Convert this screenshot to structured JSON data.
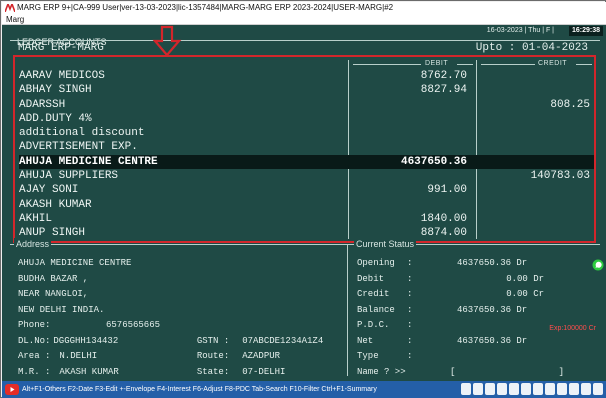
{
  "window": {
    "title": "MARG ERP 9+|CA-999 User|ver-13-03-2023|lic-1357484|MARG-MARG ERP 2023-2024|USER-MARG|#2"
  },
  "menu": {
    "label": "Marg"
  },
  "appbar": {
    "date": "16-03-2023 | Thu | F |",
    "time": "16:29:38"
  },
  "screen": {
    "title": "LEDGER ACCOUNTS",
    "company": "MARG ERP-MARG",
    "upto": "Upto : 01-04-2023"
  },
  "ledger": {
    "col_debit": "DEBIT",
    "col_credit": "CREDIT",
    "rows": [
      {
        "name": "AARAV MEDICOS",
        "debit": "8762.70",
        "credit": ""
      },
      {
        "name": "ABHAY SINGH",
        "debit": "8827.94",
        "credit": ""
      },
      {
        "name": "ADARSSH",
        "debit": "",
        "credit": "808.25"
      },
      {
        "name": "ADD.DUTY 4%",
        "debit": "",
        "credit": ""
      },
      {
        "name": "additional discount",
        "debit": "",
        "credit": ""
      },
      {
        "name": "ADVERTISEMENT EXP.",
        "debit": "",
        "credit": ""
      },
      {
        "name": "AHUJA MEDICINE CENTRE",
        "debit": "4637650.36",
        "credit": ""
      },
      {
        "name": "AHUJA SUPPLIERS",
        "debit": "",
        "credit": "140783.03"
      },
      {
        "name": "AJAY SONI",
        "debit": "991.00",
        "credit": ""
      },
      {
        "name": "AKASH KUMAR",
        "debit": "",
        "credit": ""
      },
      {
        "name": "AKHIL",
        "debit": "1840.00",
        "credit": ""
      },
      {
        "name": "ANUP SINGH",
        "debit": "8874.00",
        "credit": ""
      }
    ]
  },
  "address": {
    "heading": "Address",
    "line1": "AHUJA MEDICINE CENTRE",
    "line2": "BUDHA BAZAR ,",
    "line3": "NEAR NANGLOI,",
    "line4": "NEW DELHI INDIA.",
    "phone_label": "Phone:",
    "phone": "6576565665",
    "dlno_label": "DL.No:",
    "dlno": "DGGGHH134432",
    "gstn_label": "GSTN :",
    "gstn": "07ABCDE1234A1Z4",
    "area_label": "Area :",
    "area": "N.DELHI",
    "route_label": "Route:",
    "route": "AZADPUR",
    "mr_label": "M.R. :",
    "mr": "AKASH KUMAR",
    "state_label": "State:",
    "state": "07-DELHI"
  },
  "status": {
    "heading": "Current Status",
    "opening_label": "Opening",
    "opening": "4637650.36 Dr",
    "debit_label": "Debit",
    "debit": "0.00 Dr",
    "credit_label": "Credit",
    "credit": "0.00 Cr",
    "balance_label": "Balance",
    "balance": "4637650.36 Dr",
    "pdc_label": "P.D.C.",
    "pdc_exp": "Exp:100000 Cr",
    "net_label": "Net",
    "net": "4637650.36 Dr",
    "type_label": "Type",
    "name_label": "Name ? >>",
    "name_open": "[",
    "name_close": "]"
  },
  "footer": {
    "keys": "Alt+F1-Others F2-Date F3-Edit +-Envelope F4-Interest F6-Adjust F8-PDC Tab-Search F10-Filter Ctrl+F1-Summary"
  },
  "colors": {
    "screen_bg": "#1f4a45",
    "highlight_box": "#d3262b",
    "selected_row": "#091a18",
    "footer_bg": "#245fa8",
    "exp_red": "#ff4d4d"
  }
}
